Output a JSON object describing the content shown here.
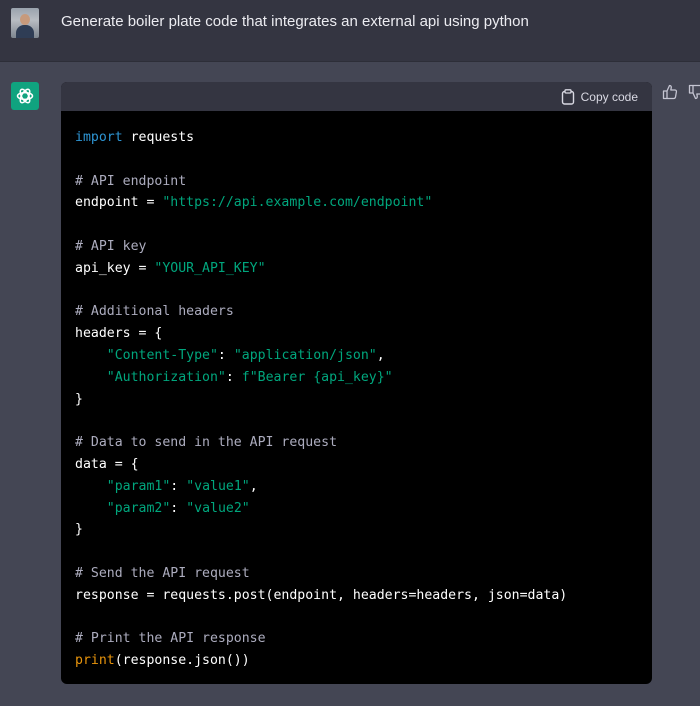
{
  "user_message": {
    "text": "Generate boiler plate code that integrates an external api using python"
  },
  "code_block": {
    "copy_label": "Copy code",
    "lines": [
      [
        {
          "t": "kw",
          "v": "import"
        },
        {
          "t": "pl",
          "v": " requests"
        }
      ],
      [],
      [
        {
          "t": "cm",
          "v": "# API endpoint"
        }
      ],
      [
        {
          "t": "pl",
          "v": "endpoint = "
        },
        {
          "t": "str",
          "v": "\"https://api.example.com/endpoint\""
        }
      ],
      [],
      [
        {
          "t": "cm",
          "v": "# API key"
        }
      ],
      [
        {
          "t": "pl",
          "v": "api_key = "
        },
        {
          "t": "str",
          "v": "\"YOUR_API_KEY\""
        }
      ],
      [],
      [
        {
          "t": "cm",
          "v": "# Additional headers"
        }
      ],
      [
        {
          "t": "pl",
          "v": "headers = {"
        }
      ],
      [
        {
          "t": "pl",
          "v": "    "
        },
        {
          "t": "str",
          "v": "\"Content-Type\""
        },
        {
          "t": "pl",
          "v": ": "
        },
        {
          "t": "str",
          "v": "\"application/json\""
        },
        {
          "t": "pl",
          "v": ","
        }
      ],
      [
        {
          "t": "pl",
          "v": "    "
        },
        {
          "t": "str",
          "v": "\"Authorization\""
        },
        {
          "t": "pl",
          "v": ": "
        },
        {
          "t": "str",
          "v": "f\"Bearer {api_key}\""
        }
      ],
      [
        {
          "t": "pl",
          "v": "}"
        }
      ],
      [],
      [
        {
          "t": "cm",
          "v": "# Data to send in the API request"
        }
      ],
      [
        {
          "t": "pl",
          "v": "data = {"
        }
      ],
      [
        {
          "t": "pl",
          "v": "    "
        },
        {
          "t": "str",
          "v": "\"param1\""
        },
        {
          "t": "pl",
          "v": ": "
        },
        {
          "t": "str",
          "v": "\"value1\""
        },
        {
          "t": "pl",
          "v": ","
        }
      ],
      [
        {
          "t": "pl",
          "v": "    "
        },
        {
          "t": "str",
          "v": "\"param2\""
        },
        {
          "t": "pl",
          "v": ": "
        },
        {
          "t": "str",
          "v": "\"value2\""
        }
      ],
      [
        {
          "t": "pl",
          "v": "}"
        }
      ],
      [],
      [
        {
          "t": "cm",
          "v": "# Send the API request"
        }
      ],
      [
        {
          "t": "pl",
          "v": "response = requests.post(endpoint, headers=headers, json=data)"
        }
      ],
      [],
      [
        {
          "t": "cm",
          "v": "# Print the API response"
        }
      ],
      [
        {
          "t": "fn",
          "v": "print"
        },
        {
          "t": "pl",
          "v": "(response.json())"
        }
      ]
    ]
  },
  "icons": {
    "user_avatar": "avatar",
    "assistant_logo": "openai-logo-icon",
    "copy": "clipboard-icon",
    "thumbs_up": "thumbs-up-icon",
    "thumbs_down": "thumbs-down-icon"
  },
  "colors": {
    "user_background": "#343541",
    "assistant_background": "#444654",
    "code_background": "#000000",
    "code_header": "#343541",
    "logo_green": "#10a37f",
    "keyword": "#2e95d3",
    "string": "#00a67d",
    "comment": "#acacbe",
    "function": "#e9950c"
  }
}
